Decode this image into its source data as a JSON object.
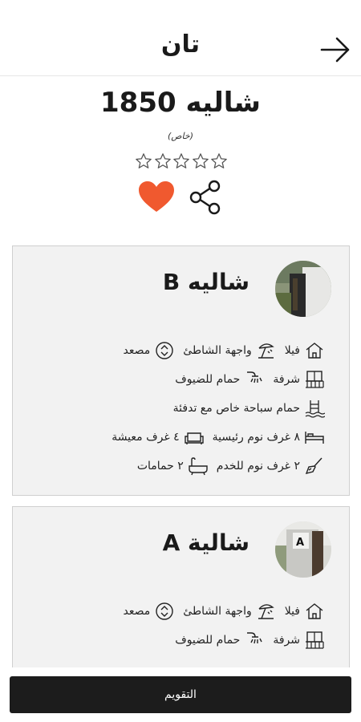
{
  "header": {
    "title": "تان",
    "back_icon": "arrow-right-icon"
  },
  "property": {
    "name": "شاليه 1850",
    "subtitle": "(خاص)",
    "rating_stars_filled": 0,
    "rating_stars_total": 5,
    "favorite_color": "#f0592f",
    "favorite_icon": "heart-icon",
    "share_icon": "share-icon"
  },
  "units": [
    {
      "name": "شاليه B",
      "features": {
        "villa": "فيلا",
        "beachfront": "واجهة الشاطئ",
        "elevator": "مصعد",
        "balcony": "شرفة",
        "guest_bath": "حمام للضيوف",
        "pool": "حمام سباحة خاص مع تدفئة",
        "master_bedrooms": "٨ غرف نوم رئيسية",
        "living_rooms": "٤ غرف معيشة",
        "maid_rooms": "٢ غرف نوم للخدم",
        "bathrooms": "٢ حمامات"
      }
    },
    {
      "name": "شالية A",
      "features": {
        "villa": "فيلا",
        "beachfront": "واجهة الشاطئ",
        "elevator": "مصعد",
        "balcony": "شرفة",
        "guest_bath": "حمام للضيوف"
      }
    }
  ],
  "rate_button": "التقويم"
}
